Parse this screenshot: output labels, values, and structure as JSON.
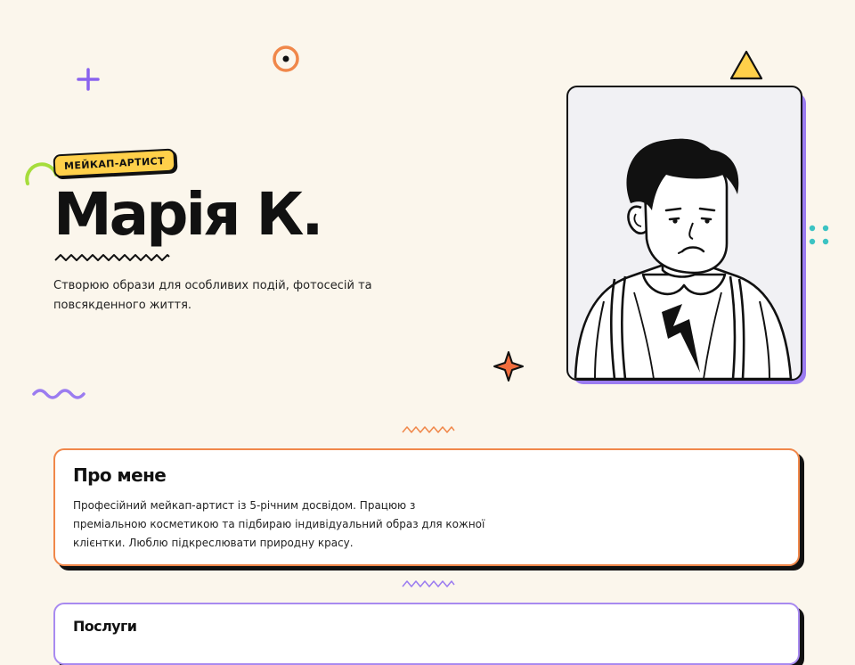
{
  "hero": {
    "badge": "МЕЙКАП-АРТИСТ",
    "name": "Марія К.",
    "tagline": "Створюю образи для особливих подій, фотосесій та повсякденного життя."
  },
  "about": {
    "title": "Про мене",
    "text": "Професійний мейкап-артист із 5-річним досвідом. Працюю з преміальною косметикою та підбираю індивідуальний образ для кожної клієнтки. Люблю підкреслювати природну красу."
  },
  "services": {
    "title": "Послуги"
  },
  "colors": {
    "background": "#fbf6ec",
    "accent_yellow": "#ffd04a",
    "accent_orange": "#f0874a",
    "accent_purple": "#9b7cf0",
    "accent_teal": "#3cc3c3",
    "accent_green": "#a6dd3c",
    "ink": "#111111"
  },
  "icons": [
    "plus-icon",
    "ring-icon",
    "triangle-icon",
    "arc-icon",
    "dots-icon",
    "wave-icon",
    "sparkle-icon",
    "avatar-illustration"
  ]
}
